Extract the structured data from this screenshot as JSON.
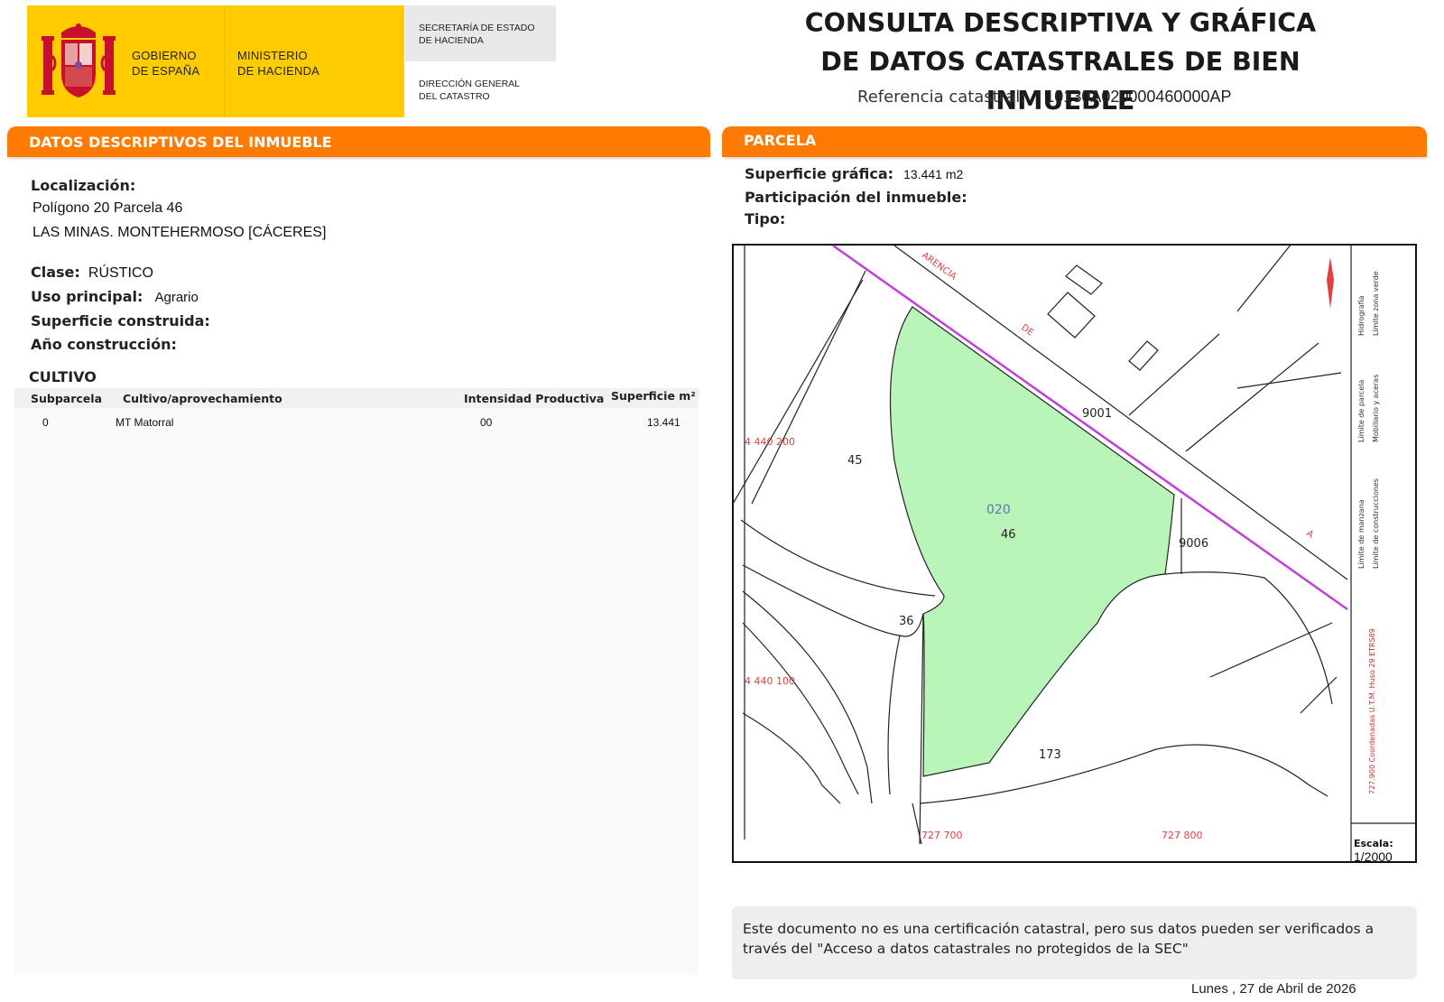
{
  "header": {
    "gov_line1": "GOBIERNO",
    "gov_line2": "DE ESPAÑA",
    "min_line1": "MINISTERIO",
    "min_line2": "DE HACIENDA",
    "sec_line1": "SECRETARÍA DE ESTADO",
    "sec_line2": "DE HACIENDA",
    "dir_line1": "DIRECCIÓN GENERAL",
    "dir_line2": "DEL CATASTRO",
    "title_line1": "CONSULTA DESCRIPTIVA Y GRÁFICA",
    "title_line2": "DE DATOS CATASTRALES DE BIEN INMUEBLE",
    "ref_label": "Referencia catastral:",
    "ref_value": "10130A020000460000AP"
  },
  "descriptive": {
    "section_title": "DATOS DESCRIPTIVOS DEL INMUEBLE",
    "location_label": "Localización:",
    "location_line1": "Polígono 20 Parcela 46",
    "location_line2": "LAS MINAS. MONTEHERMOSO [CÁCERES]",
    "class_label": "Clase:",
    "class_value": "RÚSTICO",
    "use_label": "Uso principal:",
    "use_value": "Agrario",
    "built_label": "Superficie construida:",
    "year_label": "Año construcción:",
    "crop_heading": "CULTIVO",
    "columns": [
      "Subparcela",
      "Cultivo/aprovechamiento",
      "Intensidad Productiva",
      "Superficie m²"
    ],
    "rows": [
      {
        "subparcela": "0",
        "cultivo": "MT Matorral",
        "intensidad": "00",
        "superficie": "13.441"
      }
    ]
  },
  "parcel": {
    "section_title": "PARCELA",
    "surface_label": "Superficie gráfica:",
    "surface_value": "13.441 m2",
    "share_label": "Participación del inmueble:",
    "type_label": "Tipo:"
  },
  "map": {
    "parcel_fill": "#b9f5b9",
    "boundary_color": "#c040d8",
    "coord_color": "#e04040",
    "labels": {
      "p45": "45",
      "p46": "46",
      "p020": "020",
      "p36": "36",
      "p173": "173",
      "p9001": "9001",
      "p9006": "9006",
      "road1": "ARENCIA",
      "road2": "DE",
      "road3": "A",
      "y1": "4 440 200",
      "y2": "4 440 100",
      "x1": "727 700",
      "x2": "727 800"
    },
    "legend": {
      "item1": "Hidrografía",
      "item2": "Límite zona verde",
      "item3": "Límite de parcela",
      "item4": "Mobiliario y aceras",
      "item5": "Límite de manzana",
      "item6": "Límite de construcciones",
      "coords": "727.900 Coordenadas U.T.M. Huso 29 ETRS89"
    },
    "scale_label": "Escala:",
    "scale_value": "1/2000"
  },
  "footer": {
    "note_line1": "Este documento no es una certificación catastral, pero sus datos pueden ser verificados a",
    "note_line2": "través del \"Acceso a datos catastrales no protegidos de la SEC\"",
    "date": "Lunes , 27 de Abril de 2026"
  }
}
